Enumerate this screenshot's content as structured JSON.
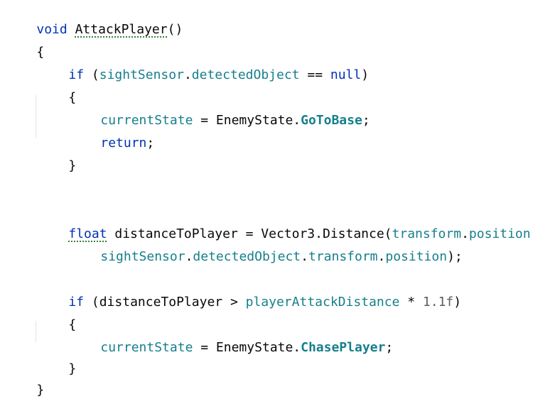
{
  "code": {
    "l1": {
      "t1": "void",
      "t2": "AttackPlayer",
      "t3": "()"
    },
    "l2": {
      "t1": "{"
    },
    "l3": {
      "t1": "if",
      "t2": " (",
      "t3": "sightSensor",
      "t4": ".",
      "t5": "detectedObject",
      "t6": " == ",
      "t7": "null",
      "t8": ")"
    },
    "l4": {
      "t1": "{"
    },
    "l5": {
      "t1": "currentState",
      "t2": " = EnemyState.",
      "t3": "GoToBase",
      "t4": ";"
    },
    "l6": {
      "t1": "return",
      "t2": ";"
    },
    "l7": {
      "t1": "}"
    },
    "l8": {
      "t1": "float",
      "t2": " distanceToPlayer = Vector3.Distance(",
      "t3": "transform",
      "t4": ".",
      "t5": "position",
      "t6": ","
    },
    "l9": {
      "t1": "sightSensor",
      "t2": ".",
      "t3": "detectedObject",
      "t4": ".",
      "t5": "transform",
      "t6": ".",
      "t7": "position",
      "t8": ");"
    },
    "l10": {
      "t1": "if",
      "t2": " (distanceToPlayer > ",
      "t3": "playerAttackDistance",
      "t4": " * ",
      "t5": "1.1f",
      "t6": ")"
    },
    "l11": {
      "t1": "{"
    },
    "l12": {
      "t1": "currentState",
      "t2": " = EnemyState.",
      "t3": "ChasePlayer",
      "t4": ";"
    },
    "l13": {
      "t1": "}"
    },
    "l14": {
      "t1": "}"
    }
  },
  "colors": {
    "keyword": "#0033b3",
    "field": "#167f8c",
    "number": "#5d5d5d",
    "text": "#080808",
    "background": "#ffffff"
  }
}
